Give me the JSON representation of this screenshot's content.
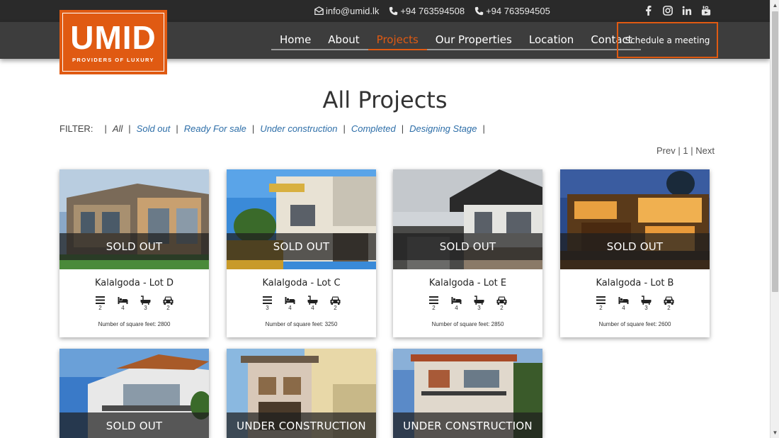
{
  "topbar": {
    "email": "info@umid.lk",
    "phone1": "+94 763594508",
    "phone2": "+94 763594505",
    "social": [
      "facebook-icon",
      "instagram-icon",
      "linkedin-icon",
      "youtube-icon"
    ]
  },
  "logo": {
    "text": "UMID",
    "tagline": "PROVIDERS OF LUXURY"
  },
  "nav": {
    "items": [
      {
        "label": "Home"
      },
      {
        "label": "About"
      },
      {
        "label": "Projects",
        "active": true
      },
      {
        "label": "Our Properties"
      },
      {
        "label": "Location"
      },
      {
        "label": "Contact"
      }
    ],
    "cta": "Schedule a meeting"
  },
  "page": {
    "title": "All Projects",
    "filter_label": "FILTER:",
    "filters": [
      "All",
      "Sold out",
      "Ready For sale",
      "Under construction",
      "Completed",
      "Designing Stage"
    ],
    "pager": {
      "prev": "Prev",
      "sep1": "|",
      "page": "1",
      "sep2": "|",
      "next": "Next"
    }
  },
  "colors": {
    "accent": "#e05a12",
    "topbar": "#2a2a2a",
    "navbar": "#3d3d3d",
    "link": "#2d6ea8"
  },
  "projects": [
    {
      "name": "Kalalgoda - Lot D",
      "status": "SOLD OUT",
      "floors": "2",
      "beds": "4",
      "baths": "3",
      "parking": "2",
      "sqft": "Number of square feet: 2800"
    },
    {
      "name": "Kalalgoda - Lot C",
      "status": "SOLD OUT",
      "floors": "3",
      "beds": "4",
      "baths": "4",
      "parking": "2",
      "sqft": "Number of square feet: 3250"
    },
    {
      "name": "Kalalgoda - Lot E",
      "status": "SOLD OUT",
      "floors": "2",
      "beds": "4",
      "baths": "3",
      "parking": "2",
      "sqft": "Number of square feet: 2850"
    },
    {
      "name": "Kalalgoda - Lot B",
      "status": "SOLD OUT",
      "floors": "2",
      "beds": "4",
      "baths": "3",
      "parking": "2",
      "sqft": "Number of square feet: 2600"
    },
    {
      "status": "SOLD OUT"
    },
    {
      "status": "UNDER CONSTRUCTION"
    },
    {
      "status": "UNDER CONSTRUCTION"
    }
  ]
}
